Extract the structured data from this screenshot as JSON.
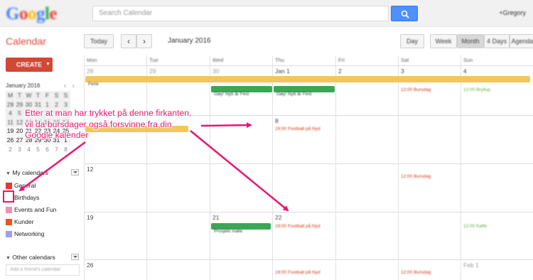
{
  "brand": {
    "logo_text": "Google"
  },
  "search": {
    "placeholder": "Search Calendar"
  },
  "user": {
    "name": "+Gregory"
  },
  "app": {
    "title": "Calendar"
  },
  "toolbar": {
    "today_label": "Today",
    "prev_label": "‹",
    "next_label": "›",
    "date_range": "January 2016",
    "views": [
      "Day",
      "Week",
      "Month",
      "4 Days",
      "Agenda"
    ],
    "active_view": "Month"
  },
  "sidebar": {
    "create_label": "CREATE",
    "mini_calendar": {
      "title": "January 2016",
      "prev": "‹",
      "next": "›",
      "weekdays": [
        "M",
        "T",
        "W",
        "T",
        "F",
        "S",
        "S"
      ],
      "weeks": [
        [
          "28",
          "29",
          "30",
          "31",
          "1",
          "2",
          "3"
        ],
        [
          "4",
          "5",
          "6",
          "7",
          "8",
          "9",
          "10"
        ],
        [
          "11",
          "12",
          "13",
          "14",
          "15",
          "16",
          "17"
        ],
        [
          "19",
          "20",
          "21",
          "22",
          "23",
          "24",
          "25"
        ],
        [
          "26",
          "27",
          "28",
          "29",
          "30",
          "31",
          "1"
        ],
        [
          "2",
          "3",
          "4",
          "5",
          "6",
          "7",
          "8"
        ]
      ]
    },
    "my_calendars_label": "My calendars",
    "my_calendars": [
      {
        "label": "General",
        "color": "#e53935"
      },
      {
        "label": "Birthdays",
        "color": "#ffffff"
      },
      {
        "label": "Events and Fun",
        "color": "#f48fb1"
      },
      {
        "label": "Kunder",
        "color": "#f4511e"
      },
      {
        "label": "Networking",
        "color": "#9e9ef0"
      }
    ],
    "other_calendars_label": "Other calendars",
    "friend_placeholder": "Add a friend's calendar"
  },
  "grid": {
    "weekdays": [
      "Mon",
      "Tue",
      "Wed",
      "Thu",
      "Fri",
      "Sat",
      "Sun"
    ],
    "weeks": [
      [
        "28",
        "29",
        "30",
        "Jan 1",
        "2",
        "3",
        "4"
      ],
      [
        "",
        "",
        "",
        "8",
        "",
        "",
        ""
      ],
      [
        "12",
        "",
        "",
        "",
        "",
        "",
        ""
      ],
      [
        "19",
        "",
        "21",
        "22",
        "",
        "",
        ""
      ],
      [
        "26",
        "",
        "",
        "",
        "",
        "",
        "Feb 1"
      ]
    ],
    "events": {
      "ferie": "Ferie",
      "fest1": "Gøy! Nytt år Fest",
      "fest2": "Gøy! Nytt år Fest",
      "sat1": "12:00 Bursdag",
      "sun1": "12:00 Bryllup",
      "thu2": "19:00 Football på Nyd",
      "sat3": "12:00 Bursdag",
      "wed4": "Prosjekt møte",
      "thu4": "19:00 Football på Nyd",
      "sun4": "12:00 Kaffe",
      "thu5": "19:00 Football på Nyd",
      "sat5": "12:00 Bursdag"
    },
    "colors": {
      "ferie": "#f1c75b",
      "green": "#3aa757",
      "red_text": "#d33b1c",
      "green_text": "#62b03a"
    }
  },
  "annotation": {
    "text": "Etter at man har trykket på denne firkanten, vil da bursdager også forsvinne fra din Google kalender",
    "color": "#e8166f"
  }
}
